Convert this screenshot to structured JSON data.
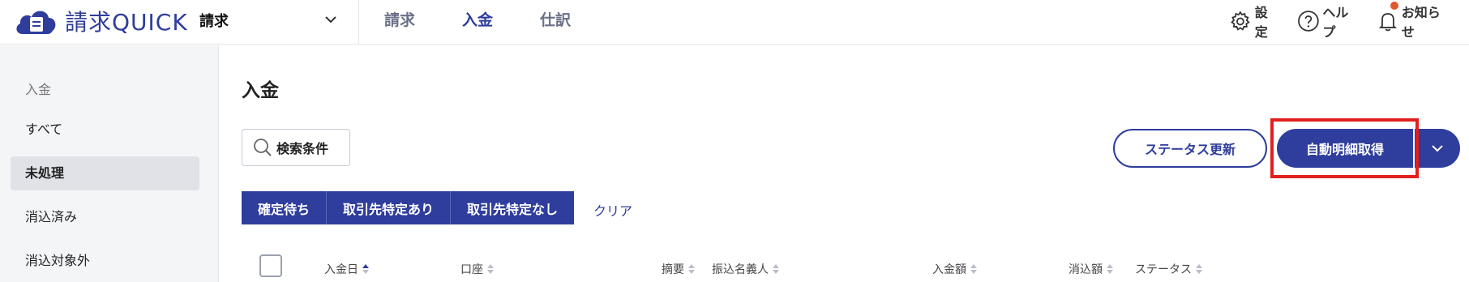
{
  "app": {
    "logo_text": "請求QUICK",
    "service_selected": "請求"
  },
  "nav": [
    {
      "label": "請求",
      "active": false
    },
    {
      "label": "入金",
      "active": true
    },
    {
      "label": "仕訳",
      "active": false
    }
  ],
  "header_right": {
    "settings": "設定",
    "help": "ヘルプ",
    "notices": "お知らせ"
  },
  "sidebar": {
    "heading": "入金",
    "items": [
      {
        "label": "すべて",
        "active": false
      },
      {
        "label": "未処理",
        "active": true
      },
      {
        "label": "消込済み",
        "active": false
      },
      {
        "label": "消込対象外",
        "active": false
      }
    ]
  },
  "main": {
    "title": "入金",
    "search_label": "検索条件",
    "status_update_label": "ステータス更新",
    "auto_fetch_label": "自動明細取得",
    "filters": [
      "確定待ち",
      "取引先特定あり",
      "取引先特定なし"
    ],
    "clear_label": "クリア"
  },
  "table": {
    "columns": [
      "入金日",
      "口座",
      "摘要",
      "振込名義人",
      "入金額",
      "消込額",
      "ステータス"
    ]
  },
  "colors": {
    "accent": "#2f3d9c",
    "highlight": "#e21f1f",
    "notice_dot": "#e2572b"
  }
}
